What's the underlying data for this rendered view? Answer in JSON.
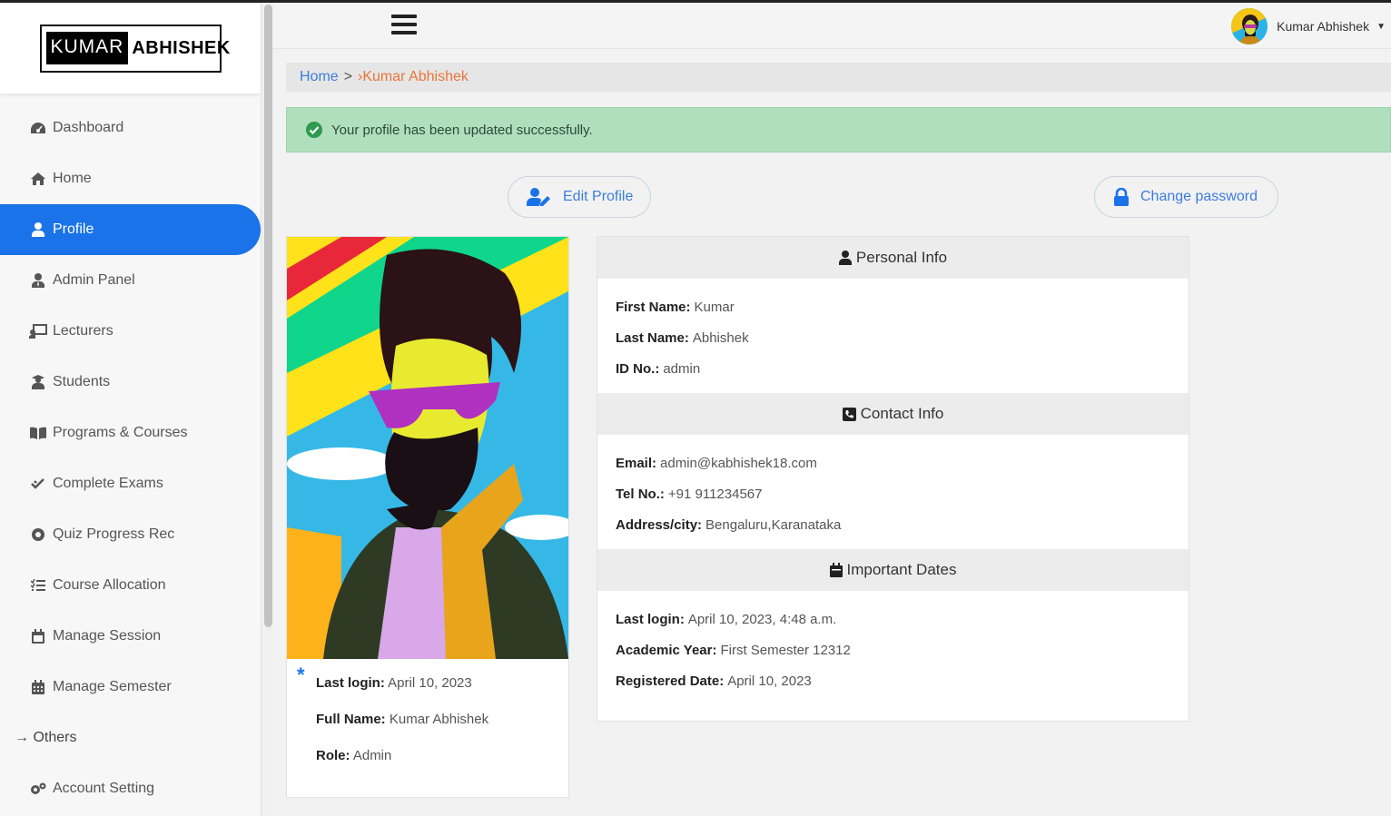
{
  "brand": {
    "logo_left": "KUMAR",
    "logo_right": "ABHISHEK"
  },
  "sidebar": {
    "items": [
      {
        "label": "Dashboard",
        "icon": "dashboard-icon"
      },
      {
        "label": "Home",
        "icon": "home-icon"
      },
      {
        "label": "Profile",
        "icon": "user-icon",
        "active": true
      },
      {
        "label": "Admin Panel",
        "icon": "user-tie-icon"
      },
      {
        "label": "Lecturers",
        "icon": "chalkboard-teacher-icon"
      },
      {
        "label": "Students",
        "icon": "user-graduate-icon"
      },
      {
        "label": "Programs & Courses",
        "icon": "book-open-icon"
      },
      {
        "label": "Complete Exams",
        "icon": "check-double-icon"
      },
      {
        "label": "Quiz Progress Rec",
        "icon": "record-icon"
      },
      {
        "label": "Course Allocation",
        "icon": "tasks-icon"
      },
      {
        "label": "Manage Session",
        "icon": "calendar-icon"
      },
      {
        "label": "Manage Semester",
        "icon": "calendar-grid-icon"
      }
    ],
    "section_label": "→ Others",
    "extra_items": [
      {
        "label": "Account Setting",
        "icon": "cogs-icon"
      }
    ]
  },
  "topbar": {
    "user_name": "Kumar Abhishek"
  },
  "breadcrumb": {
    "home": "Home",
    "separator": ">",
    "current": "›Kumar Abhishek"
  },
  "alert": {
    "message": "Your profile has been updated successfully.",
    "color": "#b0dfbd"
  },
  "actions": {
    "edit_profile": "Edit Profile",
    "change_password": "Change password"
  },
  "profile_card": {
    "last_login_label": "Last login:",
    "last_login": "April 10, 2023",
    "full_name_label": "Full Name:",
    "full_name": "Kumar Abhishek",
    "role_label": "Role:",
    "role": "Admin"
  },
  "personal_info": {
    "title": "Personal Info",
    "first_name_label": "First Name:",
    "first_name": "Kumar",
    "last_name_label": "Last Name:",
    "last_name": "Abhishek",
    "id_label": "ID No.:",
    "id": "admin"
  },
  "contact_info": {
    "title": "Contact Info",
    "email_label": "Email:",
    "email": "admin@kabhishek18.com",
    "tel_label": "Tel No.:",
    "tel": "+91 911234567",
    "address_label": "Address/city:",
    "address": "Bengaluru,Karanataka"
  },
  "important_dates": {
    "title": "Important Dates",
    "last_login_label": "Last login:",
    "last_login": "April 10, 2023, 4:48 a.m.",
    "academic_year_label": "Academic Year:",
    "academic_year": "First Semester 12312",
    "registered_label": "Registered Date:",
    "registered": "April 10, 2023"
  },
  "colors": {
    "accent": "#1a73e8",
    "link": "#3b7ddd",
    "breadcrumb_current": "#e8753a"
  }
}
